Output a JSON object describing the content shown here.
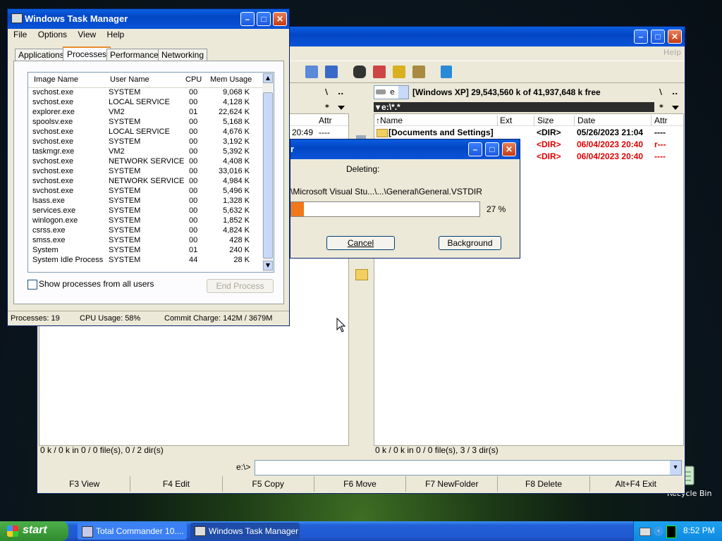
{
  "task_manager": {
    "title": "Windows Task Manager",
    "menu": [
      "File",
      "Options",
      "View",
      "Help"
    ],
    "tabs": [
      "Applications",
      "Processes",
      "Performance",
      "Networking"
    ],
    "active_tab": "Processes",
    "columns": [
      "Image Name",
      "User Name",
      "CPU",
      "Mem Usage"
    ],
    "processes": [
      {
        "name": "svchost.exe",
        "user": "SYSTEM",
        "cpu": "00",
        "mem": "9,068 K"
      },
      {
        "name": "svchost.exe",
        "user": "LOCAL SERVICE",
        "cpu": "00",
        "mem": "4,128 K"
      },
      {
        "name": "explorer.exe",
        "user": "VM2",
        "cpu": "01",
        "mem": "22,624 K"
      },
      {
        "name": "spoolsv.exe",
        "user": "SYSTEM",
        "cpu": "00",
        "mem": "5,168 K"
      },
      {
        "name": "svchost.exe",
        "user": "LOCAL SERVICE",
        "cpu": "00",
        "mem": "4,676 K"
      },
      {
        "name": "svchost.exe",
        "user": "SYSTEM",
        "cpu": "00",
        "mem": "3,192 K"
      },
      {
        "name": "taskmgr.exe",
        "user": "VM2",
        "cpu": "00",
        "mem": "5,392 K"
      },
      {
        "name": "svchost.exe",
        "user": "NETWORK SERVICE",
        "cpu": "00",
        "mem": "4,408 K"
      },
      {
        "name": "svchost.exe",
        "user": "SYSTEM",
        "cpu": "00",
        "mem": "33,016 K"
      },
      {
        "name": "svchost.exe",
        "user": "NETWORK SERVICE",
        "cpu": "00",
        "mem": "4,984 K"
      },
      {
        "name": "svchost.exe",
        "user": "SYSTEM",
        "cpu": "00",
        "mem": "5,496 K"
      },
      {
        "name": "lsass.exe",
        "user": "SYSTEM",
        "cpu": "00",
        "mem": "1,328 K"
      },
      {
        "name": "services.exe",
        "user": "SYSTEM",
        "cpu": "00",
        "mem": "5,632 K"
      },
      {
        "name": "winlogon.exe",
        "user": "SYSTEM",
        "cpu": "00",
        "mem": "1,852 K"
      },
      {
        "name": "csrss.exe",
        "user": "SYSTEM",
        "cpu": "00",
        "mem": "4,824 K"
      },
      {
        "name": "smss.exe",
        "user": "SYSTEM",
        "cpu": "00",
        "mem": "428 K"
      },
      {
        "name": "System",
        "user": "SYSTEM",
        "cpu": "01",
        "mem": "240 K"
      },
      {
        "name": "System Idle Process",
        "user": "SYSTEM",
        "cpu": "44",
        "mem": "28 K"
      }
    ],
    "show_all_label": "Show processes from all users",
    "end_process_label": "End Process",
    "status": {
      "processes": "Processes: 19",
      "cpu": "CPU Usage: 58%",
      "commit": "Commit Charge: 142M / 3679M"
    }
  },
  "total_commander": {
    "help_label": "Help",
    "left": {
      "root_label": "\\",
      "up_label": "..",
      "star_label": "*",
      "attr_header": "Attr",
      "partial_row_time": "20:49",
      "partial_row_attr": "----",
      "status": "0 k / 0 k in 0 / 0 file(s), 0 / 2 dir(s)"
    },
    "right": {
      "drive_letter": "e",
      "drive_info": "[Windows XP]  29,543,560 k of 41,937,648 k free",
      "root_label": "\\",
      "up_label": "..",
      "star_label": "*",
      "path": "e:\\*.*",
      "columns": [
        "Name",
        "Ext",
        "Size",
        "Date",
        "Attr"
      ],
      "rows": [
        {
          "name": "[Documents and Settings]",
          "size": "<DIR>",
          "date": "05/26/2023 21:04",
          "attr": "----",
          "red": false
        },
        {
          "name": "",
          "size": "<DIR>",
          "date": "06/04/2023 20:40",
          "attr": "r---",
          "red": true
        },
        {
          "name": "",
          "size": "<DIR>",
          "date": "06/04/2023 20:40",
          "attr": "----",
          "red": true
        }
      ],
      "status": "0 k / 0 k in 0 / 0 file(s), 3 / 3 dir(s)"
    },
    "cmd_prompt": "e:\\>",
    "fkeys": [
      "F3 View",
      "F4 Edit",
      "F5 Copy",
      "F6 Move",
      "F7 NewFolder",
      "F8 Delete",
      "Alt+F4 Exit"
    ]
  },
  "delete_dialog": {
    "title_partial": "r",
    "heading": "Deleting:",
    "path": "\\Microsoft Visual Stu...\\...\\General\\General.VSTDIR",
    "progress_percent": 27,
    "progress_label": "27 %",
    "cancel_label": "Cancel",
    "background_label": "Background"
  },
  "desktop": {
    "recycle_label": "Recycle Bin"
  },
  "taskbar": {
    "start_label": "start",
    "items": [
      "Total Commander 10....",
      "Windows Task Manager"
    ],
    "clock": "8:52 PM"
  }
}
